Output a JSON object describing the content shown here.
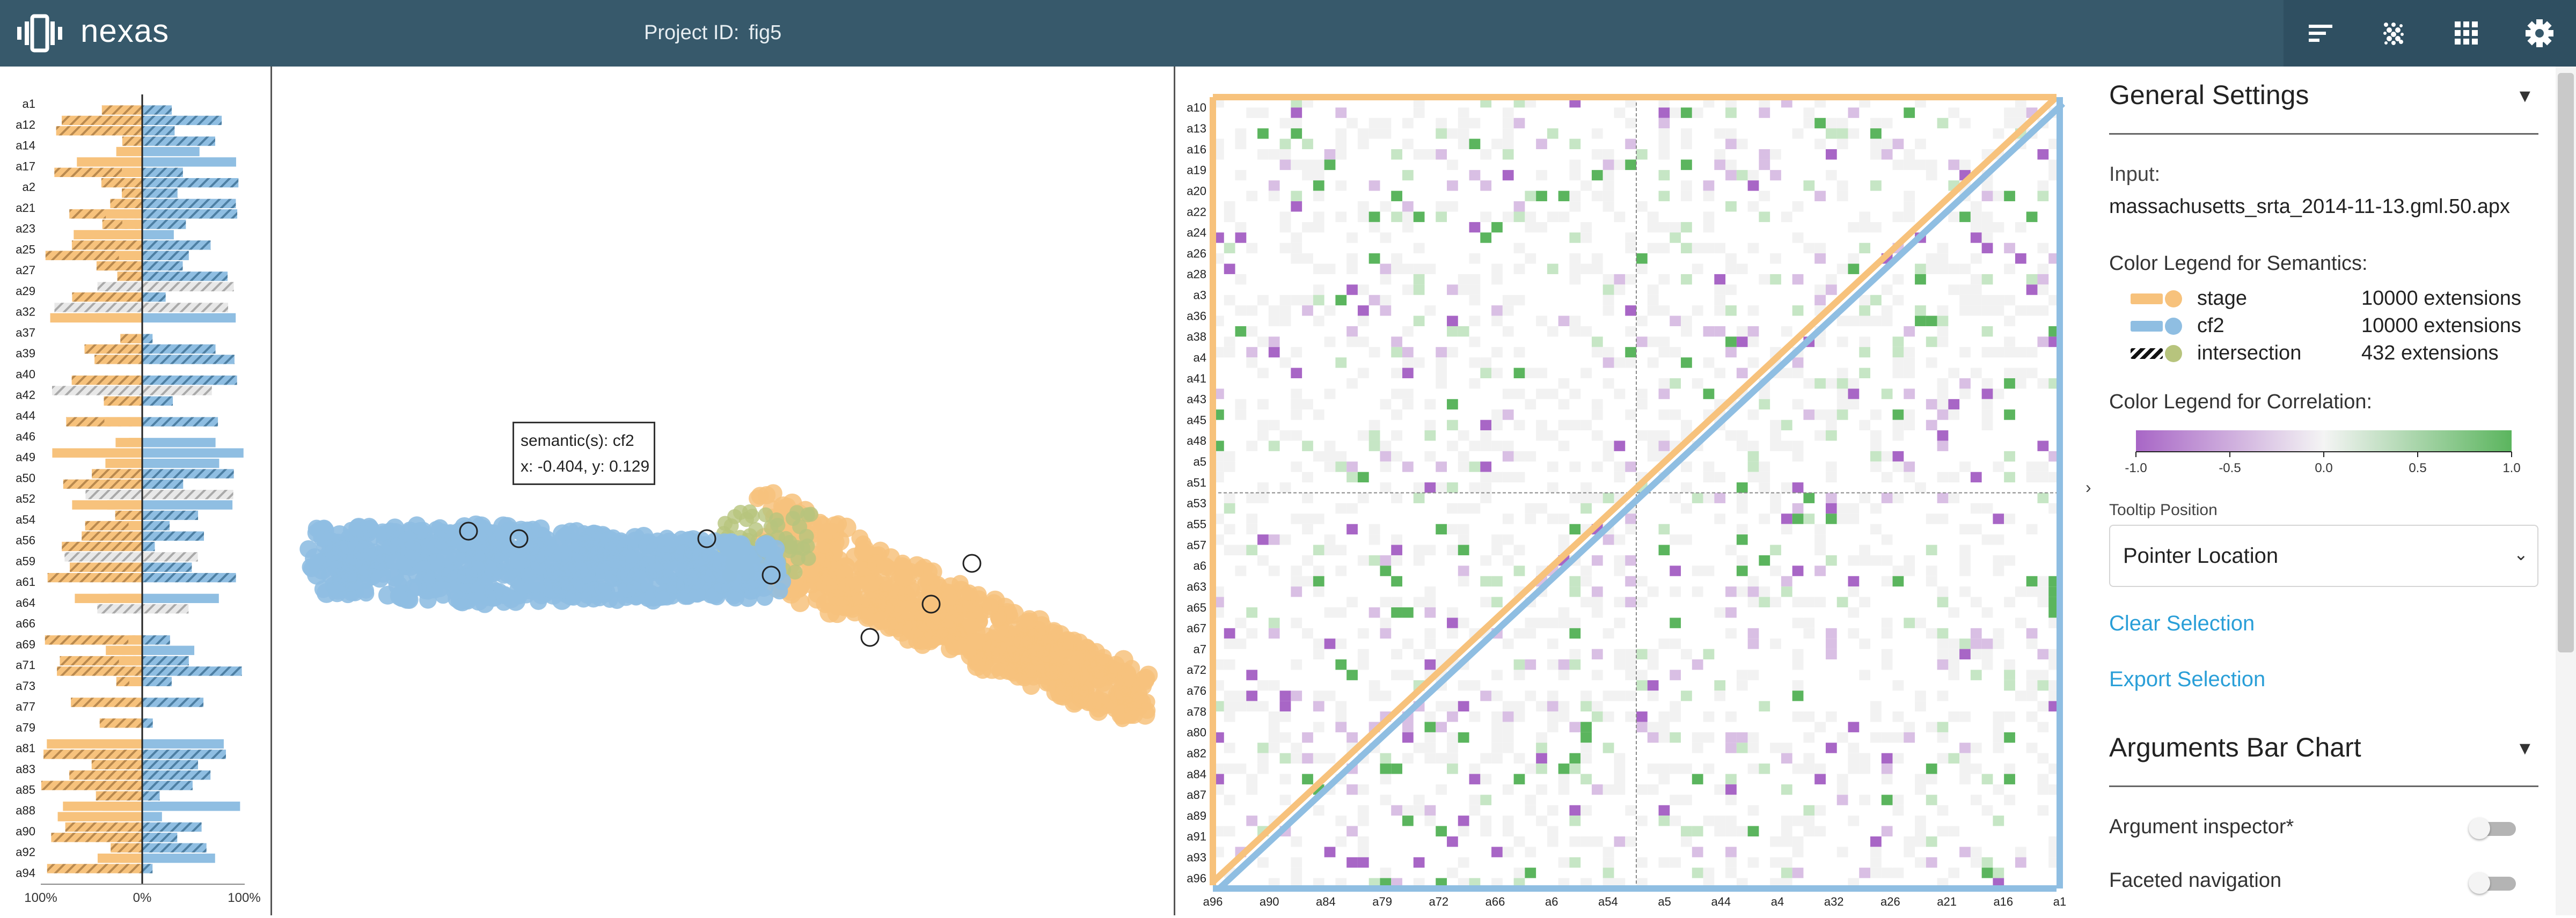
{
  "app": {
    "name": "nexas",
    "project_label": "Project ID:",
    "project_id": "fig5"
  },
  "toolbar": {
    "icons": [
      "sort-lines-icon",
      "scatter-dots-icon",
      "grid-apps-icon",
      "settings-gear-icon"
    ]
  },
  "colors": {
    "stage": "#f7c27c",
    "cf2": "#8fbee2",
    "intersection_dot": "#b7c47d",
    "topbar": "#37596b",
    "link": "#2a9fd8",
    "corr_neg": "#a866c6",
    "corr_pos": "#5bb55e"
  },
  "bar_chart": {
    "arguments": [
      "a1",
      "a12",
      "a14",
      "a17",
      "a2",
      "a21",
      "a23",
      "a25",
      "a27",
      "a29",
      "a32",
      "a37",
      "a39",
      "a40",
      "a42",
      "a44",
      "a46",
      "a49",
      "a50",
      "a52",
      "a54",
      "a56",
      "a59",
      "a61",
      "a64",
      "a66",
      "a69",
      "a71",
      "a73",
      "a77",
      "a79",
      "a81",
      "a83",
      "a85",
      "a88",
      "a90",
      "a92",
      "a94"
    ],
    "axis_labels": [
      "100%",
      "0%",
      "100%"
    ]
  },
  "scatter": {
    "tooltip": {
      "line1": "semantic(s): cf2",
      "line2": "x: -0.404, y: 0.129"
    }
  },
  "matrix": {
    "row_labels": [
      "a10",
      "a13",
      "a16",
      "a19",
      "a20",
      "a22",
      "a24",
      "a26",
      "a28",
      "a3",
      "a36",
      "a38",
      "a4",
      "a41",
      "a43",
      "a45",
      "a48",
      "a5",
      "a51",
      "a53",
      "a55",
      "a57",
      "a6",
      "a63",
      "a65",
      "a67",
      "a7",
      "a72",
      "a76",
      "a78",
      "a80",
      "a82",
      "a84",
      "a87",
      "a89",
      "a91",
      "a93",
      "a96"
    ],
    "col_labels": [
      "a96",
      "a90",
      "a84",
      "a79",
      "a72",
      "a66",
      "a6",
      "a54",
      "a5",
      "a44",
      "a4",
      "a32",
      "a26",
      "a21",
      "a16",
      "a1"
    ]
  },
  "settings": {
    "general_title": "General Settings",
    "input_label": "Input:",
    "input_value": "massachusetts_srta_2014-11-13.gml.50.apx",
    "semantics_legend_title": "Color Legend for Semantics:",
    "legend": [
      {
        "name": "stage",
        "count": "10000 extensions"
      },
      {
        "name": "cf2",
        "count": "10000 extensions"
      },
      {
        "name": "intersection",
        "count": "432 extensions"
      }
    ],
    "correlation_legend_title": "Color Legend for Correlation:",
    "correlation_ticks": [
      "-1.0",
      "-0.5",
      "0.0",
      "0.5",
      "1.0"
    ],
    "tooltip_position_label": "Tooltip Position",
    "tooltip_position_value": "Pointer Location",
    "clear_selection": "Clear Selection",
    "export_selection": "Export Selection",
    "bar_chart_title": "Arguments Bar Chart",
    "argument_inspector_label": "Argument inspector*",
    "argument_inspector_on": false,
    "faceted_navigation_label": "Faceted navigation",
    "faceted_navigation_on": false
  }
}
